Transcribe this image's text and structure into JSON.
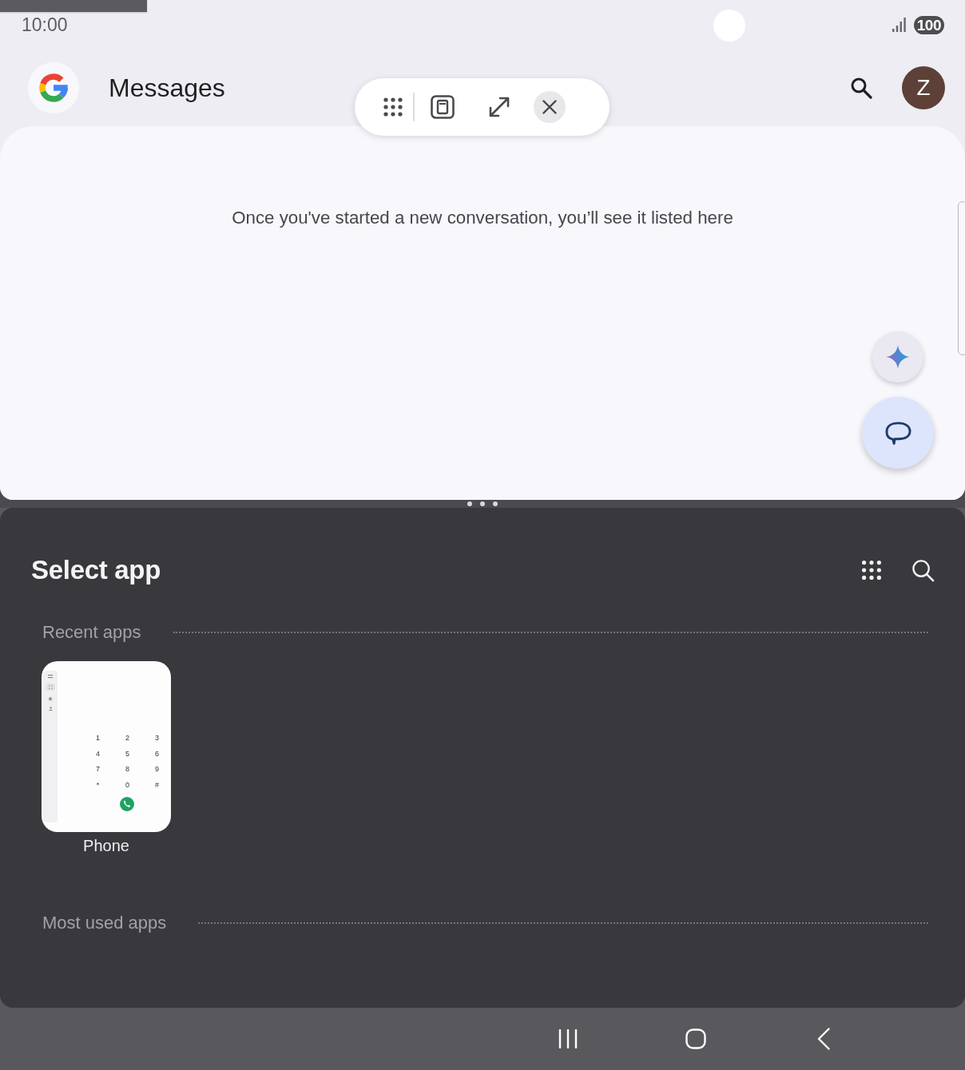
{
  "status_bar": {
    "time": "10:00",
    "battery": "100"
  },
  "header": {
    "title": "Messages",
    "avatar_initial": "Z"
  },
  "conversations": {
    "empty_message": "Once you've started a new conversation, you’ll see it listed here"
  },
  "app_picker": {
    "title": "Select app",
    "sections": [
      {
        "title": "Recent apps",
        "apps": [
          {
            "name": "Phone",
            "preview_keys": [
              "1",
              "2",
              "3",
              "4",
              "5",
              "6",
              "7",
              "8",
              "9",
              "*",
              "0",
              "#"
            ]
          }
        ]
      },
      {
        "title": "Most used apps"
      }
    ]
  }
}
